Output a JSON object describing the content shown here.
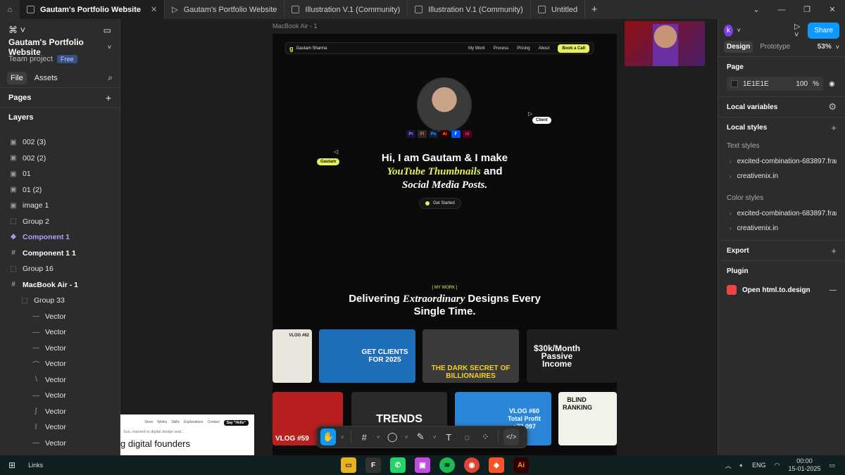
{
  "tabs": [
    {
      "label": "Gautam's Portfolio Website",
      "active": true
    },
    {
      "label": "Gautam's Portfolio Website",
      "active": false
    },
    {
      "label": "Illustration V.1 (Community)",
      "active": false
    },
    {
      "label": "Illustration V.1 (Community)",
      "active": false
    },
    {
      "label": "Untitled",
      "active": false
    }
  ],
  "left": {
    "project_title": "Gautam's Portfolio Website",
    "team": "Team project",
    "badge": "Free",
    "file_tab": "File",
    "assets_tab": "Assets",
    "pages_title": "Pages",
    "layers_title": "Layers",
    "layers": [
      {
        "name": "002 (3)",
        "icon": "image-icon"
      },
      {
        "name": "002 (2)",
        "icon": "image-icon"
      },
      {
        "name": "01",
        "icon": "image-icon"
      },
      {
        "name": "01 (2)",
        "icon": "image-icon"
      },
      {
        "name": "image 1",
        "icon": "image-icon"
      },
      {
        "name": "Group 2",
        "icon": "group-icon"
      },
      {
        "name": "Component 1",
        "icon": "component-icon"
      },
      {
        "name": "Component 1 1",
        "icon": "frame-icon"
      },
      {
        "name": "Group 16",
        "icon": "group-icon"
      },
      {
        "name": "MacBook Air - 1",
        "icon": "frame-icon"
      },
      {
        "name": "Group 33",
        "icon": "group-icon"
      },
      {
        "name": "Vector",
        "icon": "vector-icon"
      },
      {
        "name": "Vector",
        "icon": "vector-icon"
      },
      {
        "name": "Vector",
        "icon": "vector-icon"
      },
      {
        "name": "Vector",
        "icon": "vector-icon"
      },
      {
        "name": "Vector",
        "icon": "vector-icon"
      },
      {
        "name": "Vector",
        "icon": "vector-icon"
      },
      {
        "name": "Vector",
        "icon": "vector-icon"
      },
      {
        "name": "Vector",
        "icon": "vector-icon"
      },
      {
        "name": "Vector",
        "icon": "vector-icon"
      }
    ]
  },
  "canvas": {
    "frame_label": "MacBook Air - 1",
    "site": {
      "brand": "Gautam Sharma",
      "nav_links": [
        "My Work",
        "Process",
        "Pricing",
        "About"
      ],
      "cta": "Book a Call",
      "tools": [
        "Pr",
        "Fi",
        "Ps",
        "Ai",
        "F",
        "Id"
      ],
      "hero_line1": "Hi, I am Gautam & I make",
      "hero_yt": "YouTube Thumbnails",
      "hero_and": "and",
      "hero_line3": "Social Media Posts.",
      "get_started": "Get Started",
      "mywork_label": "[ MY WORK ]",
      "h2_pre": "Delivering",
      "h2_it": "Extraordinary",
      "h2_post": "Designs Every",
      "h2_line2": "Single Time.",
      "thumbs": [
        {
          "text": "VLOG #62",
          "bg": "#e9e6de",
          "fg": "#222"
        },
        {
          "text": "GET CLIENTS FOR 2025",
          "bg": "#1f6fb8",
          "fg": "#fff"
        },
        {
          "text": "THE DARK SECRET OF BILLIONAIRES",
          "bg": "#3a3a3a",
          "fg": "#f5d02a"
        },
        {
          "text": "$30k/Month Passive Income",
          "bg": "#1f1f1f",
          "fg": "#fff"
        },
        {
          "text": "VLOG #59",
          "bg": "#b81f1f",
          "fg": "#fff"
        },
        {
          "text": "TRENDS",
          "bg": "#2b2b2b",
          "fg": "#fff"
        },
        {
          "text": "VLOG #60 Total Profit +73,097",
          "bg": "#2a86d8",
          "fg": "#fff"
        },
        {
          "text": "BLIND RANKING",
          "bg": "#f2f2ea",
          "fg": "#111"
        }
      ]
    },
    "comment_gautam": "Gautam",
    "comment_client": "Client",
    "floating_nav": [
      "Store",
      "Works",
      "Skills",
      "Explorations",
      "Contact"
    ],
    "floating_btn": "Say \"Hello\"",
    "floating_text": "Sun, married to digital design and...",
    "floating_big": "g digital founders"
  },
  "right": {
    "avatar_letter": "k",
    "share": "Share",
    "design_tab": "Design",
    "prototype_tab": "Prototype",
    "zoom": "53%",
    "page_title": "Page",
    "page_color": "1E1E1E",
    "page_opacity": "100",
    "page_pct": "%",
    "local_variables": "Local variables",
    "local_styles": "Local styles",
    "text_styles_label": "Text styles",
    "text_styles": [
      "excited-combination-683897.framer...",
      "creativenix.in"
    ],
    "color_styles_label": "Color styles",
    "color_styles": [
      "excited-combination-683897.framer...",
      "creativenix.in"
    ],
    "export": "Export",
    "plugin": "Plugin",
    "plugin_item": "Open html.to.design"
  },
  "taskbar": {
    "links": "Links",
    "lang": "ENG",
    "time": "00:00",
    "date": "15-01-2025"
  }
}
